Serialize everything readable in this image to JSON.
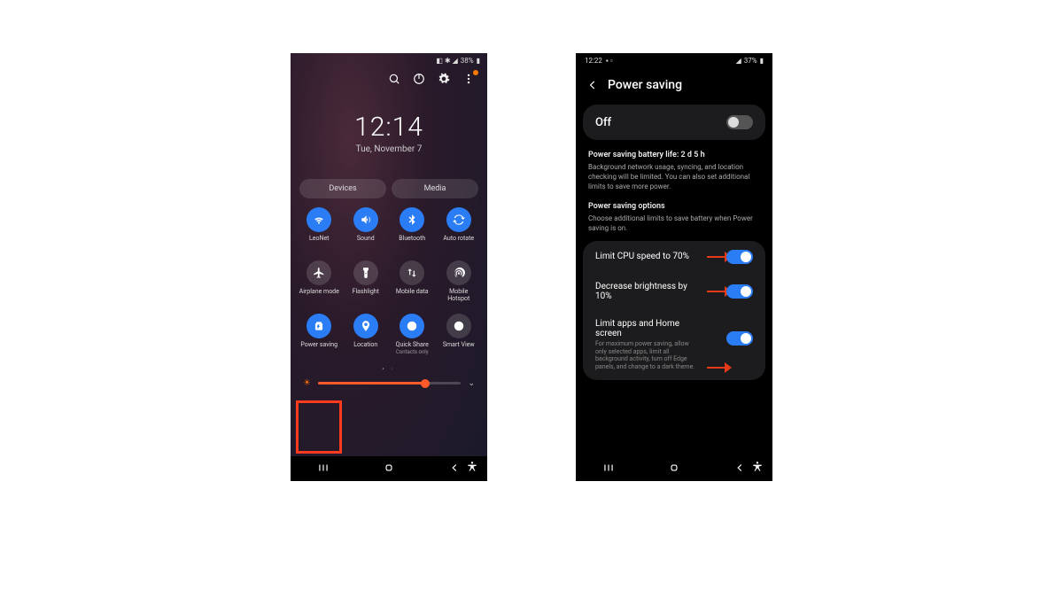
{
  "colors": {
    "accent_blue": "#2a7df5",
    "callout_red": "#ff3b1f",
    "arrow_red": "#e53a1a",
    "brightness_orange": "#ff5a2a"
  },
  "phone1": {
    "status": {
      "battery_text": "38%",
      "icons": "◧ ✱ ⚡"
    },
    "actions": [
      "search",
      "power",
      "settings",
      "more"
    ],
    "time": "12:14",
    "date": "Tue, November 7",
    "tabs": {
      "devices": "Devices",
      "media": "Media"
    },
    "tiles": [
      {
        "icon": "wifi",
        "on": true,
        "label": "LeoNet"
      },
      {
        "icon": "sound",
        "on": true,
        "label": "Sound"
      },
      {
        "icon": "bluetooth",
        "on": true,
        "label": "Bluetooth"
      },
      {
        "icon": "rotate",
        "on": true,
        "label": "Auto rotate"
      },
      {
        "icon": "airplane",
        "on": false,
        "label": "Airplane mode"
      },
      {
        "icon": "flashlight",
        "on": false,
        "label": "Flashlight"
      },
      {
        "icon": "mobiledata",
        "on": false,
        "label": "Mobile data"
      },
      {
        "icon": "hotspot",
        "on": false,
        "label": "Mobile Hotspot"
      },
      {
        "icon": "powersave",
        "on": true,
        "label": "Power saving",
        "highlighted": true
      },
      {
        "icon": "location",
        "on": true,
        "label": "Location"
      },
      {
        "icon": "quickshare",
        "on": true,
        "label": "Quick Share",
        "sub": "Contacts only"
      },
      {
        "icon": "smartview",
        "on": false,
        "label": "Smart View"
      }
    ],
    "brightness_pct": 75
  },
  "phone2": {
    "status": {
      "time": "12:22",
      "battery_text": "37%"
    },
    "title": "Power saving",
    "master": {
      "label": "Off",
      "on": false
    },
    "battery_life_label": "Power saving battery life: 2 d 5 h",
    "description": "Background network usage, syncing, and location checking will be limited. You can also set additional limits to save more power.",
    "options_heading": "Power saving options",
    "options_sub": "Choose additional limits to save battery when Power saving is on.",
    "options": [
      {
        "label": "Limit CPU speed to 70%",
        "on": true,
        "arrow": true
      },
      {
        "label": "Decrease brightness by 10%",
        "on": true,
        "arrow": true
      },
      {
        "label": "Limit apps and Home screen",
        "sub": "For maximum power saving, allow only selected apps, limit all background activity, turn off Edge panels, and change to a dark theme.",
        "on": true,
        "arrow": true
      }
    ]
  }
}
